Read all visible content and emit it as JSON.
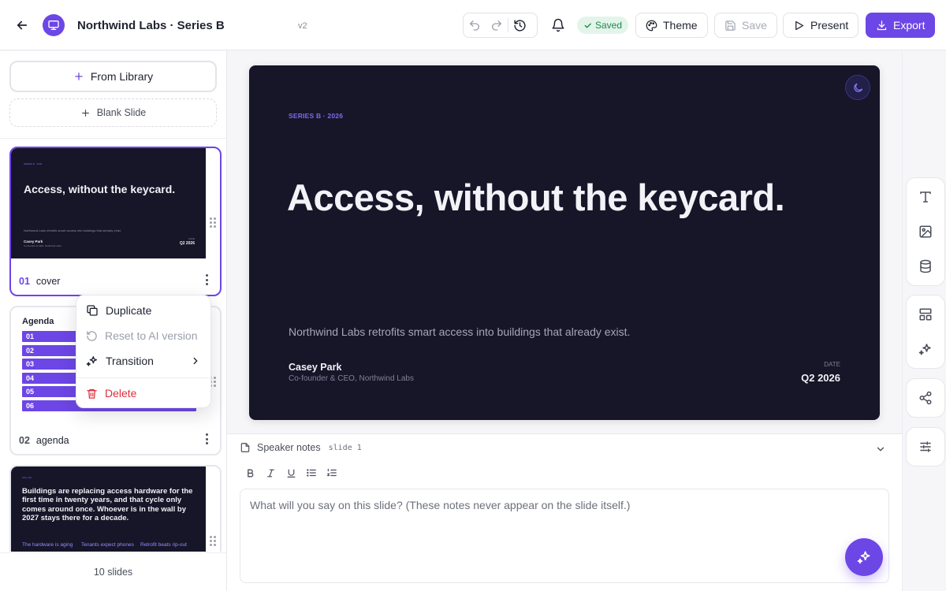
{
  "header": {
    "doc_title": "Northwind Labs · Series B",
    "version": "v2",
    "saved_label": "Saved",
    "theme_label": "Theme",
    "save_label": "Save",
    "present_label": "Present",
    "export_label": "Export"
  },
  "left_panel": {
    "from_library_label": "From Library",
    "blank_slide_label": "Blank Slide",
    "slides_count": "10 slides",
    "slides": [
      {
        "number": "01",
        "name": "cover",
        "thumb": {
          "kicker": "SERIES B · 2026",
          "title": "Access, without the keycard.",
          "subtitle": "Northwind Labs retrofits smart access into buildings that already exist.",
          "name": "Casey Park",
          "role": "Co-founder & CEO, Northwind Labs",
          "date_label": "DATE",
          "date": "Q2 2026"
        }
      },
      {
        "number": "02",
        "name": "agenda",
        "thumb": {
          "title": "Agenda",
          "rows": [
            "01",
            "02",
            "03",
            "04",
            "05",
            "06"
          ]
        }
      },
      {
        "number": "03",
        "name": "",
        "thumb": {
          "kicker": "Why now",
          "title": "Buildings are replacing access hardware for the first time in twenty years, and that cycle only comes around once. Whoever is in the wall by 2027 stays there for a decade.",
          "columns": [
            "The hardware is aging",
            "Tenants expect phones",
            "Retrofit beats rip-out"
          ]
        }
      }
    ]
  },
  "context_menu": {
    "duplicate": "Duplicate",
    "reset": "Reset to AI version",
    "transition": "Transition",
    "delete": "Delete"
  },
  "slide": {
    "kicker": "SERIES B · 2026",
    "title": "Access, without the keycard.",
    "subtitle": "Northwind Labs retrofits smart access into buildings that already exist.",
    "presenter_name": "Casey Park",
    "presenter_role": "Co-founder & CEO, Northwind Labs",
    "date_label": "DATE",
    "date": "Q2 2026"
  },
  "notes": {
    "label": "Speaker notes",
    "slide_ref": "slide 1",
    "placeholder": "What will you say on this slide? (These notes never appear on the slide itself.)"
  },
  "colors": {
    "accent": "#6d46e6",
    "slide_bg": "#171528",
    "saved_bg": "#e3f5ea",
    "saved_text": "#1e8a4a",
    "danger": "#dc2f3c"
  }
}
